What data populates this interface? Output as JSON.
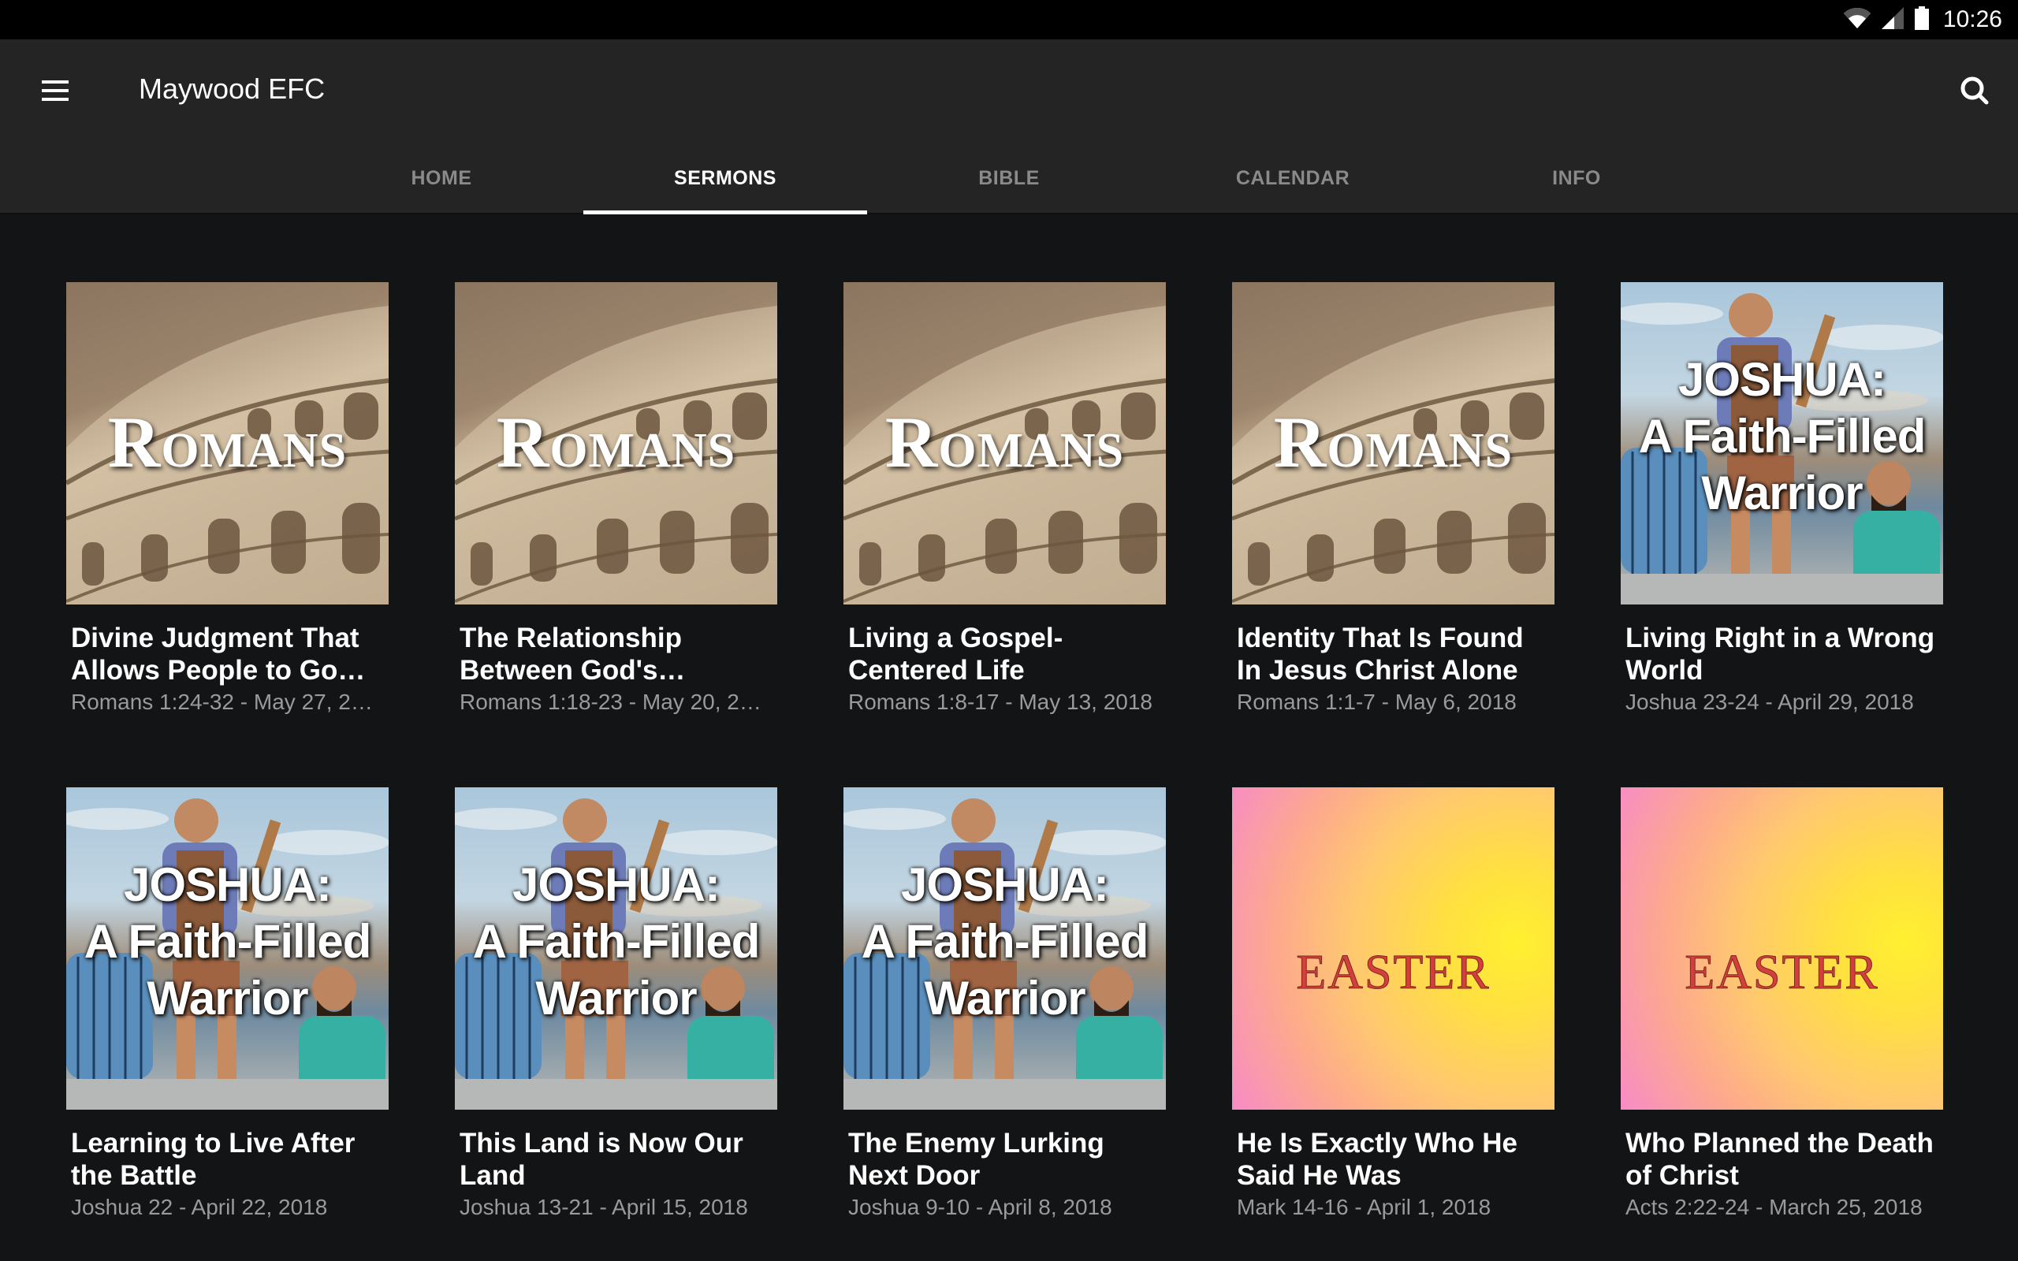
{
  "status_bar": {
    "time": "10:26",
    "icons": [
      "wifi-icon",
      "cell-signal-icon",
      "battery-icon"
    ]
  },
  "app_bar": {
    "title": "Maywood EFC",
    "menu_icon": "hamburger-menu-icon",
    "search_icon": "search-icon"
  },
  "tabs": [
    {
      "label": "HOME",
      "active": false
    },
    {
      "label": "SERMONS",
      "active": true
    },
    {
      "label": "BIBLE",
      "active": false
    },
    {
      "label": "CALENDAR",
      "active": false
    },
    {
      "label": "INFO",
      "active": false
    }
  ],
  "colors": {
    "app_bar_bg": "#242424",
    "content_bg": "#131416",
    "tab_active": "#ffffff",
    "tab_inactive": "#8a8a8a",
    "subtitle": "#9a9a9a",
    "easter_text": "#d43e3c"
  },
  "series_art": {
    "romans": {
      "line1_first": "R",
      "line1_rest": "OMANS"
    },
    "joshua": {
      "line1": "JOSHUA:",
      "line2": "A Faith-Filled",
      "line3": "Warrior"
    },
    "easter": {
      "word": "EASTER"
    }
  },
  "sermons": [
    {
      "title": "Divine Judgment That Allows People to Go…",
      "subtitle": "Romans 1:24-32 - May 27, 20…",
      "art": "romans"
    },
    {
      "title": "The Relationship Between God's…",
      "subtitle": "Romans 1:18-23 - May 20, 20…",
      "art": "romans"
    },
    {
      "title": "Living a Gospel-Centered Life",
      "subtitle": "Romans 1:8-17 - May 13, 2018",
      "art": "romans"
    },
    {
      "title": "Identity That Is Found In Jesus Christ Alone",
      "subtitle": "Romans 1:1-7 - May 6, 2018",
      "art": "romans"
    },
    {
      "title": "Living Right in a Wrong World",
      "subtitle": "Joshua 23-24 - April 29, 2018",
      "art": "joshua"
    },
    {
      "title": "Learning to Live After the Battle",
      "subtitle": "Joshua 22 - April 22, 2018",
      "art": "joshua"
    },
    {
      "title": "This Land is Now Our Land",
      "subtitle": "Joshua 13-21 - April 15, 2018",
      "art": "joshua"
    },
    {
      "title": "The Enemy Lurking Next Door",
      "subtitle": "Joshua 9-10 - April 8, 2018",
      "art": "joshua"
    },
    {
      "title": "He Is Exactly Who He Said He Was",
      "subtitle": "Mark 14-16 - April 1, 2018",
      "art": "easter"
    },
    {
      "title": "Who Planned the Death of Christ",
      "subtitle": "Acts 2:22-24 - March 25, 2018",
      "art": "easter"
    }
  ]
}
